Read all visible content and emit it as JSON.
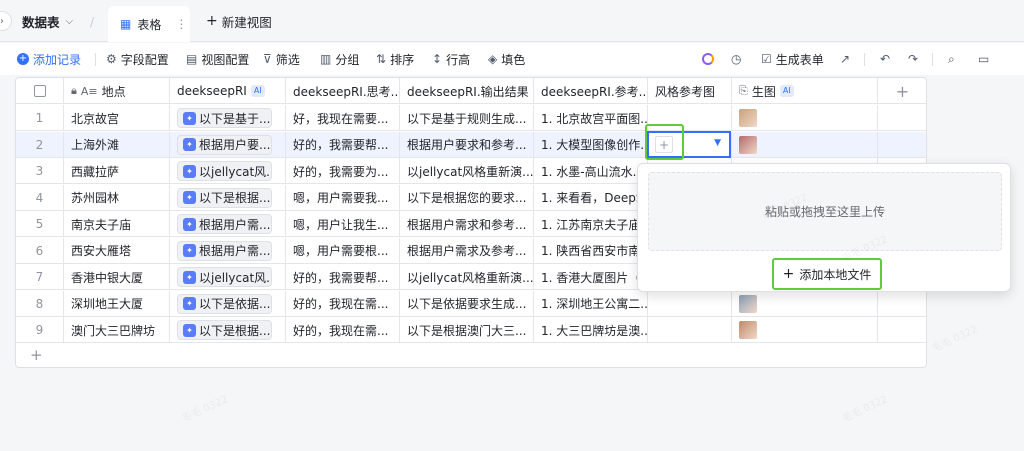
{
  "topbar": {
    "back_icon": "chevron-left-icon",
    "table_name": "数据表",
    "view_name": "表格",
    "new_view": "新建视图"
  },
  "toolbar": {
    "add_record": "添加记录",
    "field_config": "字段配置",
    "view_config": "视图配置",
    "filter": "筛选",
    "group": "分组",
    "sort": "排序",
    "row_height": "行高",
    "fill": "填色",
    "generate_form": "生成表单"
  },
  "columns": [
    {
      "label": "地点",
      "ai": false
    },
    {
      "label": "deekseepRI",
      "ai": true
    },
    {
      "label": "deekseepRI.思考...",
      "ai": false
    },
    {
      "label": "deekseepRI.输出结果",
      "ai": false
    },
    {
      "label": "deekseepRI.参考...",
      "ai": false
    },
    {
      "label": "风格参考图",
      "ai": false
    },
    {
      "label": "生图",
      "ai": true
    }
  ],
  "rows": [
    {
      "num": "1",
      "place": "北京故宫",
      "ai": "以下是基于...",
      "think": "好，我现在需要...",
      "out": "以下是基于规则生成...",
      "ref": "1. 北京故宫平面图..."
    },
    {
      "num": "2",
      "place": "上海外滩",
      "ai": "根据用户要...",
      "think": "好的，我需要帮...",
      "out": "根据用户要求和参考...",
      "ref": "1. 大模型图像创作..."
    },
    {
      "num": "3",
      "place": "西藏拉萨",
      "ai": "以jellycat风...",
      "think": "好的，我需要为...",
      "out": "以jellycat风格重新演...",
      "ref": "1. 水墨-高山流水..."
    },
    {
      "num": "4",
      "place": "苏州园林",
      "ai": "以下是根据...",
      "think": "嗯，用户需要我...",
      "out": "以下是根据您的要求...",
      "ref": "1. 来看看，DeepS..."
    },
    {
      "num": "5",
      "place": "南京夫子庙",
      "ai": "根据用户需...",
      "think": "嗯，用户让我生...",
      "out": "根据用户需求和参考...",
      "ref": "1. 江苏南京夫子庙..."
    },
    {
      "num": "6",
      "place": "西安大雁塔",
      "ai": "根据用户需...",
      "think": "嗯，用户需要根...",
      "out": "根据用户需求及参考...",
      "ref": "1. 陕西省西安市南..."
    },
    {
      "num": "7",
      "place": "香港中银大厦",
      "ai": "以jellycat风...",
      "think": "好的，我需要帮...",
      "out": "以jellycat风格重新演...",
      "ref": "1. 香港大厦图片（..."
    },
    {
      "num": "8",
      "place": "深圳地王大厦",
      "ai": "以下是依据...",
      "think": "好的，我现在需...",
      "out": "以下是依据要求生成...",
      "ref": "1. 深圳地王公寓二..."
    },
    {
      "num": "9",
      "place": "澳门大三巴牌坊",
      "ai": "以下是根据...",
      "think": "好的，我现在需...",
      "out": "以下是根据澳门大三...",
      "ref": "1. 大三巴牌坊是澳..."
    }
  ],
  "popup": {
    "upload_hint": "粘贴或拖拽至这里上传",
    "add_local": "添加本地文件"
  },
  "watermark_text": "毛毛 0322",
  "colors": {
    "accent": "#3370ff",
    "highlight": "#5ecb3c"
  }
}
